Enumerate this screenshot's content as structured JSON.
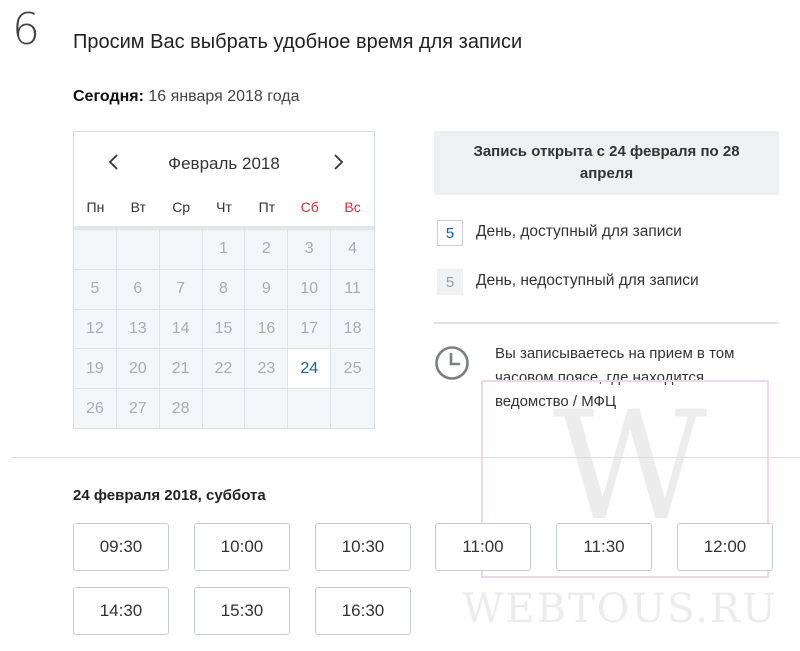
{
  "step": {
    "number": "6"
  },
  "header": {
    "title": "Просим Вас выбрать удобное время для записи"
  },
  "today": {
    "label": "Сегодня:",
    "value": "16 января 2018 года"
  },
  "calendar": {
    "month": "Февраль 2018",
    "weekdays": [
      "Пн",
      "Вт",
      "Ср",
      "Чт",
      "Пт",
      "Сб",
      "Вс"
    ],
    "days": [
      "",
      "",
      "",
      "1",
      "2",
      "3",
      "4",
      "5",
      "6",
      "7",
      "8",
      "9",
      "10",
      "11",
      "12",
      "13",
      "14",
      "15",
      "16",
      "17",
      "18",
      "19",
      "20",
      "21",
      "22",
      "23",
      "24",
      "25",
      "26",
      "27",
      "28",
      "",
      "",
      "",
      ""
    ],
    "available_day": "24",
    "weekend_color": "#d62e3c",
    "available_color": "#1c5fa3"
  },
  "info": {
    "record_open": "Запись открыта с 24 февраля по 28 апреля",
    "legend_available_num": "5",
    "legend_available": "День, доступный для записи",
    "legend_unavailable_num": "5",
    "legend_unavailable": "День, недоступный для записи",
    "timezone_note": "Вы записываетесь на прием в том часовом поясе, где находится ведомство / МФЦ"
  },
  "selected_date": "24 февраля 2018, суббота",
  "time_slots": [
    "09:30",
    "10:00",
    "10:30",
    "11:00",
    "11:30",
    "12:00",
    "14:30",
    "15:30",
    "16:30"
  ],
  "watermark": {
    "letter": "W",
    "text": "WEBTOUS.RU"
  }
}
